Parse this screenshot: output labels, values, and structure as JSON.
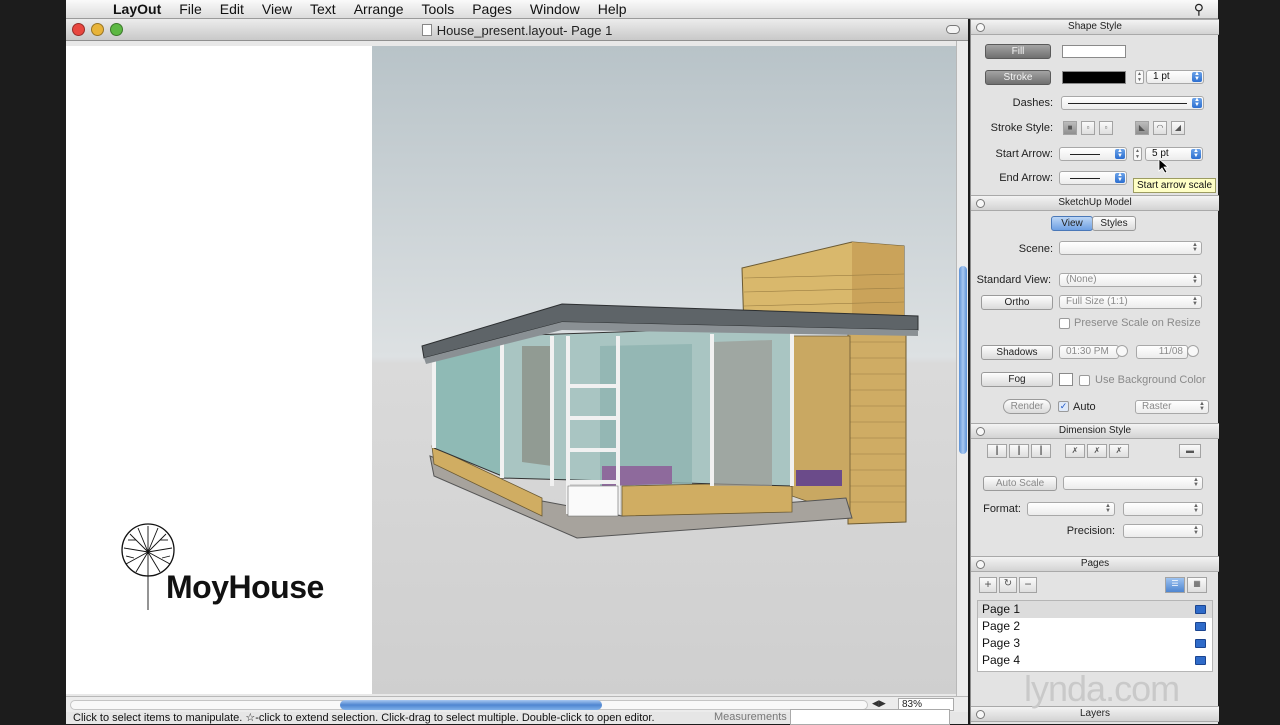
{
  "menubar": {
    "app_name": "LayOut",
    "items": [
      "File",
      "Edit",
      "View",
      "Text",
      "Arrange",
      "Tools",
      "Pages",
      "Window",
      "Help"
    ]
  },
  "window": {
    "title": "House_present.layout- Page 1"
  },
  "document": {
    "logo_text": "MoyHouse"
  },
  "zoom": "83%",
  "statusbar": {
    "hint": "Click to select items to manipulate. ☆-click to extend selection. Click-drag to select multiple. Double-click to open editor.",
    "measurements_label": "Measurements"
  },
  "shape_style": {
    "title": "Shape Style",
    "fill_label": "Fill",
    "stroke_label": "Stroke",
    "stroke_width": "1 pt",
    "dashes_label": "Dashes:",
    "stroke_style_label": "Stroke Style:",
    "start_arrow_label": "Start Arrow:",
    "start_arrow_scale": "5 pt",
    "end_arrow_label": "End Arrow:",
    "tooltip": "Start arrow scale",
    "fill_color": "#ffffff",
    "stroke_color": "#000000"
  },
  "sketchup_model": {
    "title": "SketchUp Model",
    "tab_view": "View",
    "tab_styles": "Styles",
    "scene_label": "Scene:",
    "standard_view_label": "Standard View:",
    "standard_view_value": "(None)",
    "ortho_label": "Ortho",
    "ortho_value": "Full Size (1:1)",
    "preserve_scale_label": "Preserve Scale on Resize",
    "shadows_label": "Shadows",
    "shadow_time": "01:30 PM",
    "shadow_date": "11/08",
    "fog_label": "Fog",
    "use_bg_color_label": "Use Background Color",
    "render_label": "Render",
    "auto_label": "Auto",
    "raster_value": "Raster"
  },
  "dimension_style": {
    "title": "Dimension Style",
    "auto_scale_label": "Auto Scale",
    "format_label": "Format:",
    "precision_label": "Precision:"
  },
  "pages": {
    "title": "Pages",
    "add": "+",
    "remove": "−",
    "list": [
      "Page 1",
      "Page 2",
      "Page 3",
      "Page 4"
    ]
  },
  "layers": {
    "title": "Layers"
  },
  "watermark": "lynda.com"
}
